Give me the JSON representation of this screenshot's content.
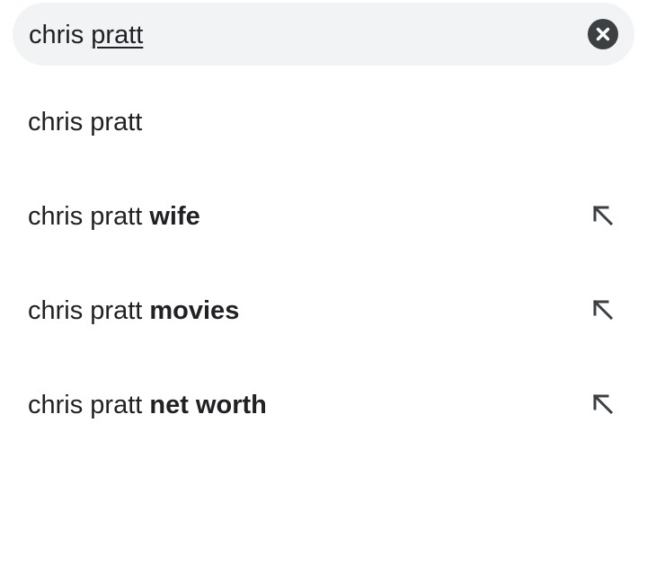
{
  "search": {
    "query_prefix": "chris ",
    "query_underlined": "pratt",
    "clear_icon": "close-circle-icon"
  },
  "suggestions": [
    {
      "base": "chris pratt",
      "bold": "",
      "has_fill_arrow": false
    },
    {
      "base": "chris pratt ",
      "bold": "wife",
      "has_fill_arrow": true,
      "fill_icon": "arrow-up-left-icon"
    },
    {
      "base": "chris pratt ",
      "bold": "movies",
      "has_fill_arrow": true,
      "fill_icon": "arrow-up-left-icon"
    },
    {
      "base": "chris pratt ",
      "bold": "net worth",
      "has_fill_arrow": true,
      "fill_icon": "arrow-up-left-icon"
    }
  ],
  "colors": {
    "search_bg": "#f1f3f4",
    "text": "#202124",
    "icon": "#3c4043"
  }
}
